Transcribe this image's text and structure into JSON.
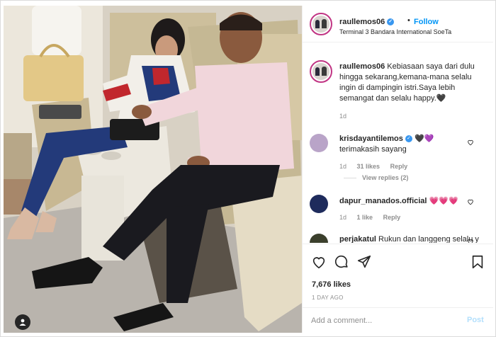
{
  "header": {
    "username": "raullemos06",
    "follow_label": "Follow",
    "dot": "•",
    "location": "Terminal 3 Bandara International SoeTa"
  },
  "caption": {
    "username": "raullemos06",
    "text": "Kebiasaan saya dari dulu hingga sekarang,kemana-mana selalu ingin di dampingin istri.Saya lebih semangat dan selalu happy.🖤",
    "age": "1d"
  },
  "comments": [
    {
      "username": "krisdayantilemos",
      "verified": true,
      "inline": "🖤💜",
      "text": "terimakasih sayang",
      "age": "1d",
      "likes": "31 likes",
      "reply_label": "Reply",
      "view_replies": "View replies (2)"
    },
    {
      "username": "dapur_manados.official",
      "verified": false,
      "inline": "💗💗💗",
      "text": "",
      "age": "1d",
      "likes": "1 like",
      "reply_label": "Reply"
    },
    {
      "username": "perjakatul",
      "verified": false,
      "inline": "",
      "text": "Rukun dan langgeng selalu y om..and safe a...",
      "age": "",
      "likes": "",
      "reply_label": ""
    }
  ],
  "actions": {
    "likes": "7,676 likes",
    "time": "1 DAY AGO",
    "icons": [
      "heart-icon",
      "comment-icon",
      "share-icon",
      "save-icon"
    ]
  },
  "add_comment": {
    "placeholder": "Add a comment...",
    "post_label": "Post"
  },
  "colors": {
    "follow_blue": "#0095f6",
    "verified_blue": "#3897f0",
    "post_disabled": "#b2dffc",
    "heart_red": "#ed4956"
  }
}
